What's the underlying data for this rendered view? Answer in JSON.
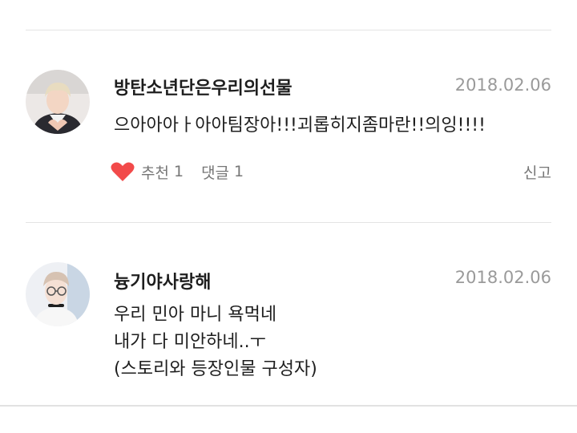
{
  "comments": [
    {
      "author": "방탄소년단은우리의선물",
      "date": "2018.02.06",
      "lines": [
        "으아아아ㅏ아아팀장아!!!괴롭히지좀마란!!의잉!!!!"
      ],
      "actions": {
        "like_label": "추천",
        "like_count": "1",
        "reply_label": "댓글",
        "reply_count": "1",
        "report_label": "신고"
      },
      "avatar_icon": "profile-photo-heart-hands"
    },
    {
      "author": "늉기야사랑해",
      "date": "2018.02.06",
      "lines": [
        "우리 민아 마니 욕먹네",
        "내가 다 미안하네..ㅜ",
        "(스토리와 등장인물 구성자)"
      ],
      "avatar_icon": "profile-photo-glasses"
    }
  ],
  "colors": {
    "heart": "#f24a4a",
    "date": "#9a9a9a",
    "divider": "#e4e4e4"
  }
}
